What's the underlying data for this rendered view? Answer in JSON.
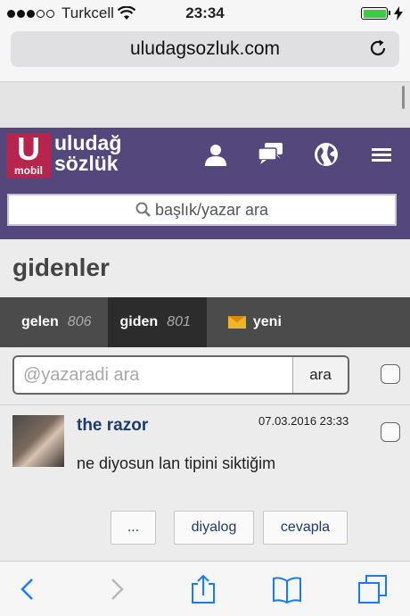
{
  "status_bar": {
    "carrier": "Turkcell",
    "time": "23:34",
    "signal_dots_filled": 3,
    "signal_dots_total": 5,
    "battery_level": 1.0,
    "icons": [
      "signal-dots-icon",
      "wifi-icon",
      "battery-icon",
      "charging-bolt-icon"
    ]
  },
  "browser": {
    "url": "uludagsozluk.com",
    "icons": [
      "reload-icon"
    ]
  },
  "site_header": {
    "logo_letter": "U",
    "logo_sub": "mobil",
    "logo_line1": "uludağ",
    "logo_line2": "sözlük",
    "icons": [
      "user-icon",
      "chat-icon",
      "globe-icon",
      "menu-icon"
    ],
    "search_placeholder": "başlık/yazar ara",
    "brand_color": "#54477b",
    "logo_color": "#b7244d"
  },
  "page": {
    "title": "gidenler"
  },
  "tabs": [
    {
      "label": "gelen",
      "count": "806"
    },
    {
      "label": "giden",
      "count": "801"
    },
    {
      "label": "yeni",
      "count": ""
    }
  ],
  "author_search": {
    "placeholder": "@yazaradi ara",
    "button": "ara"
  },
  "message": {
    "author": "the razor",
    "date": "07.03.2016 23:33",
    "body": "ne diyosun lan tipini siktiğim"
  },
  "actions": {
    "more": "...",
    "dialog": "diyalog",
    "reply": "cevapla"
  },
  "toolbar": {
    "icons": [
      "back-icon",
      "forward-icon",
      "share-icon",
      "bookmarks-icon",
      "tabs-icon"
    ],
    "accent_color": "#1a7cf5"
  }
}
